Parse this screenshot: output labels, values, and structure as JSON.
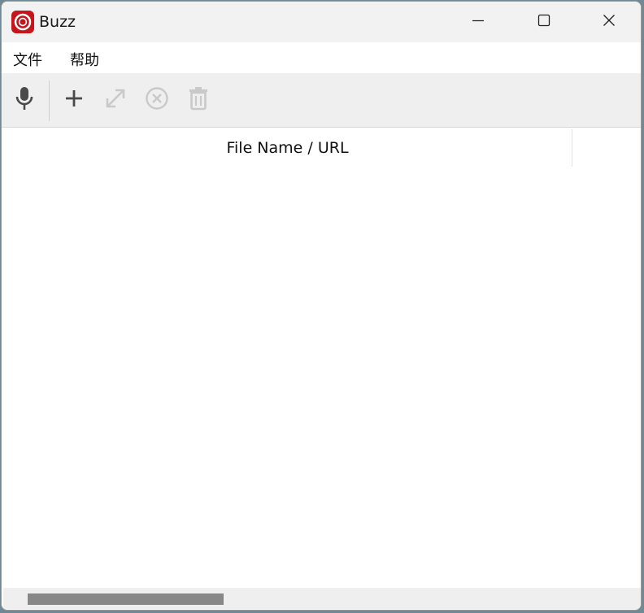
{
  "window": {
    "title": "Buzz",
    "app_icon": "buzz-logo-icon",
    "controls": [
      "minimize-icon",
      "maximize-icon",
      "close-icon"
    ]
  },
  "menubar": {
    "items": [
      {
        "label": "文件"
      },
      {
        "label": "帮助"
      }
    ]
  },
  "toolbar": {
    "buttons": [
      {
        "icon": "microphone-icon",
        "enabled": true
      },
      {
        "icon": "plus-icon",
        "enabled": true
      },
      {
        "icon": "expand-icon",
        "enabled": false
      },
      {
        "icon": "cancel-circle-icon",
        "enabled": false
      },
      {
        "icon": "trash-icon",
        "enabled": false
      }
    ]
  },
  "table": {
    "columns": [
      "File Name / URL"
    ],
    "rows": []
  },
  "colors": {
    "accent": "#c4161c",
    "enabled_icon": "#4a4a4a",
    "disabled_icon": "#c9c9c9",
    "scroll_thumb": "#888888"
  }
}
